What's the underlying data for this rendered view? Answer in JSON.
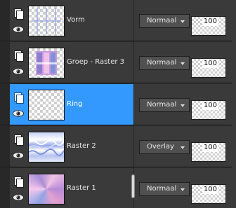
{
  "layers": [
    {
      "name": "Vorm",
      "blend": "Normaal",
      "opacity": "100",
      "thumb": "vorm-thumbnail",
      "selected": false
    },
    {
      "name": "Groep - Raster 3",
      "blend": "Normaal",
      "opacity": "100",
      "thumb": "group-thumbnail",
      "selected": false
    },
    {
      "name": "Ring",
      "blend": "Normaal",
      "opacity": "100",
      "thumb": "ring-thumbnail",
      "selected": true
    },
    {
      "name": "Raster 2",
      "blend": "Overlay",
      "opacity": "100",
      "thumb": "raster2-thumbnail",
      "selected": false
    },
    {
      "name": "Raster 1",
      "blend": "Normaal",
      "opacity": "100",
      "thumb": "raster1-thumbnail",
      "selected": false
    }
  ],
  "icons": {
    "layer_type": "layer-icon",
    "visibility": "eye-icon",
    "dropdown": "chevron-down-icon",
    "splitter": "splitter-handle-icon"
  },
  "colors": {
    "selection": "#3399ff",
    "row_background": "#3a3a3a",
    "panel_background": "#282828"
  }
}
